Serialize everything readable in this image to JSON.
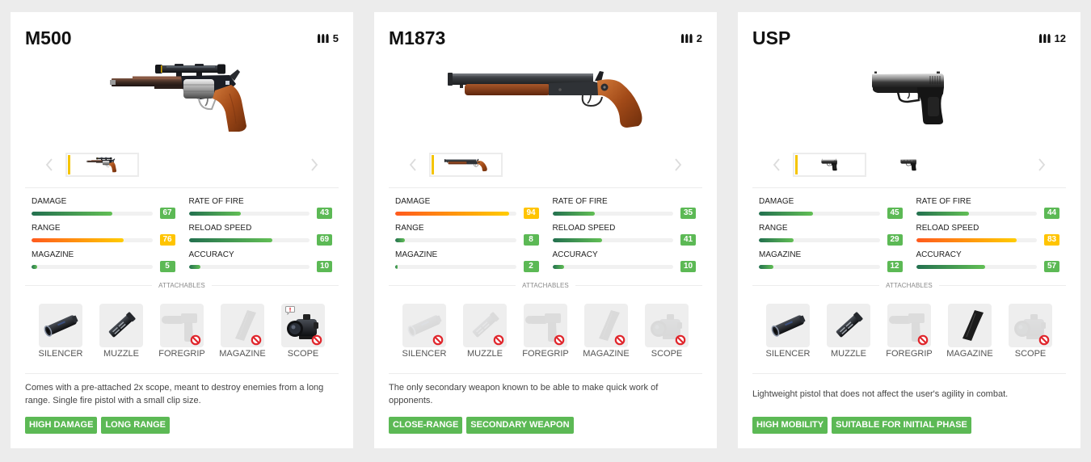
{
  "colors": {
    "background": "#ececec",
    "card": "#ffffff",
    "selected_thumbnail_marker": "#f5c400",
    "stat_normal_badge": "#5cb955",
    "stat_high_badge": "#ffc400",
    "stat_normal_bar_start": "#23704f",
    "stat_normal_bar_end": "#62bf55",
    "stat_high_bar_start": "#ff5a1e",
    "stat_high_bar_end": "#ffcc00",
    "tag": "#5cb955"
  },
  "labels": {
    "attachables": "ATTACHABLES"
  },
  "weapons": [
    {
      "name": "M500",
      "ammo": "5",
      "image": "m500-revolver",
      "thumbnails": [
        {
          "image": "m500-revolver",
          "state": "selected"
        }
      ],
      "stats": [
        {
          "label": "DAMAGE",
          "value": 67,
          "tier": "normal"
        },
        {
          "label": "RATE OF FIRE",
          "value": 43,
          "tier": "normal"
        },
        {
          "label": "RANGE",
          "value": 76,
          "tier": "high"
        },
        {
          "label": "RELOAD SPEED",
          "value": 69,
          "tier": "normal"
        },
        {
          "label": "MAGAZINE",
          "value": 5,
          "tier": "normal"
        },
        {
          "label": "ACCURACY",
          "value": 10,
          "tier": "normal"
        }
      ],
      "attachments": [
        {
          "label": "SILENCER",
          "icon": "silencer-icon",
          "state": "available"
        },
        {
          "label": "MUZZLE",
          "icon": "muzzle-icon",
          "state": "available"
        },
        {
          "label": "FOREGRIP",
          "icon": "foregrip-icon",
          "state": "unavailable"
        },
        {
          "label": "MAGAZINE",
          "icon": "magazine-icon",
          "state": "unavailable"
        },
        {
          "label": "SCOPE",
          "icon": "scope-icon",
          "state": "preattached"
        }
      ],
      "description": "Comes with a pre-attached 2x scope, meant to destroy enemies from a long range. Single fire pistol with a small clip size.",
      "tags": [
        {
          "label": "HIGH DAMAGE"
        },
        {
          "label": "LONG RANGE"
        }
      ]
    },
    {
      "name": "M1873",
      "ammo": "2",
      "image": "m1873-shotgun",
      "thumbnails": [
        {
          "image": "m1873-shotgun",
          "state": "selected"
        }
      ],
      "stats": [
        {
          "label": "DAMAGE",
          "value": 94,
          "tier": "high"
        },
        {
          "label": "RATE OF FIRE",
          "value": 35,
          "tier": "normal"
        },
        {
          "label": "RANGE",
          "value": 8,
          "tier": "normal"
        },
        {
          "label": "RELOAD SPEED",
          "value": 41,
          "tier": "normal"
        },
        {
          "label": "MAGAZINE",
          "value": 2,
          "tier": "normal"
        },
        {
          "label": "ACCURACY",
          "value": 10,
          "tier": "normal"
        }
      ],
      "attachments": [
        {
          "label": "SILENCER",
          "icon": "silencer-icon",
          "state": "unavailable"
        },
        {
          "label": "MUZZLE",
          "icon": "muzzle-icon",
          "state": "unavailable"
        },
        {
          "label": "FOREGRIP",
          "icon": "foregrip-icon",
          "state": "unavailable"
        },
        {
          "label": "MAGAZINE",
          "icon": "magazine-icon",
          "state": "unavailable"
        },
        {
          "label": "SCOPE",
          "icon": "scope-icon",
          "state": "unavailable"
        }
      ],
      "description": "The only secondary weapon known to be able to make quick work of opponents.",
      "tags": [
        {
          "label": "CLOSE-RANGE"
        },
        {
          "label": "SECONDARY WEAPON"
        }
      ]
    },
    {
      "name": "USP",
      "ammo": "12",
      "image": "usp-pistol",
      "thumbnails": [
        {
          "image": "usp-pistol",
          "state": "selected"
        },
        {
          "image": "usp-pistol-variant",
          "state": "default"
        }
      ],
      "stats": [
        {
          "label": "DAMAGE",
          "value": 45,
          "tier": "normal"
        },
        {
          "label": "RATE OF FIRE",
          "value": 44,
          "tier": "normal"
        },
        {
          "label": "RANGE",
          "value": 29,
          "tier": "normal"
        },
        {
          "label": "RELOAD SPEED",
          "value": 83,
          "tier": "high"
        },
        {
          "label": "MAGAZINE",
          "value": 12,
          "tier": "normal"
        },
        {
          "label": "ACCURACY",
          "value": 57,
          "tier": "normal"
        }
      ],
      "attachments": [
        {
          "label": "SILENCER",
          "icon": "silencer-icon",
          "state": "available"
        },
        {
          "label": "MUZZLE",
          "icon": "muzzle-icon",
          "state": "available"
        },
        {
          "label": "FOREGRIP",
          "icon": "foregrip-icon",
          "state": "unavailable"
        },
        {
          "label": "MAGAZINE",
          "icon": "magazine-icon",
          "state": "available"
        },
        {
          "label": "SCOPE",
          "icon": "scope-icon",
          "state": "unavailable"
        }
      ],
      "description": "Lightweight pistol that does not affect the user's agility in combat.",
      "tags": [
        {
          "label": "HIGH MOBILITY"
        },
        {
          "label": "SUITABLE FOR INITIAL PHASE"
        }
      ]
    }
  ]
}
